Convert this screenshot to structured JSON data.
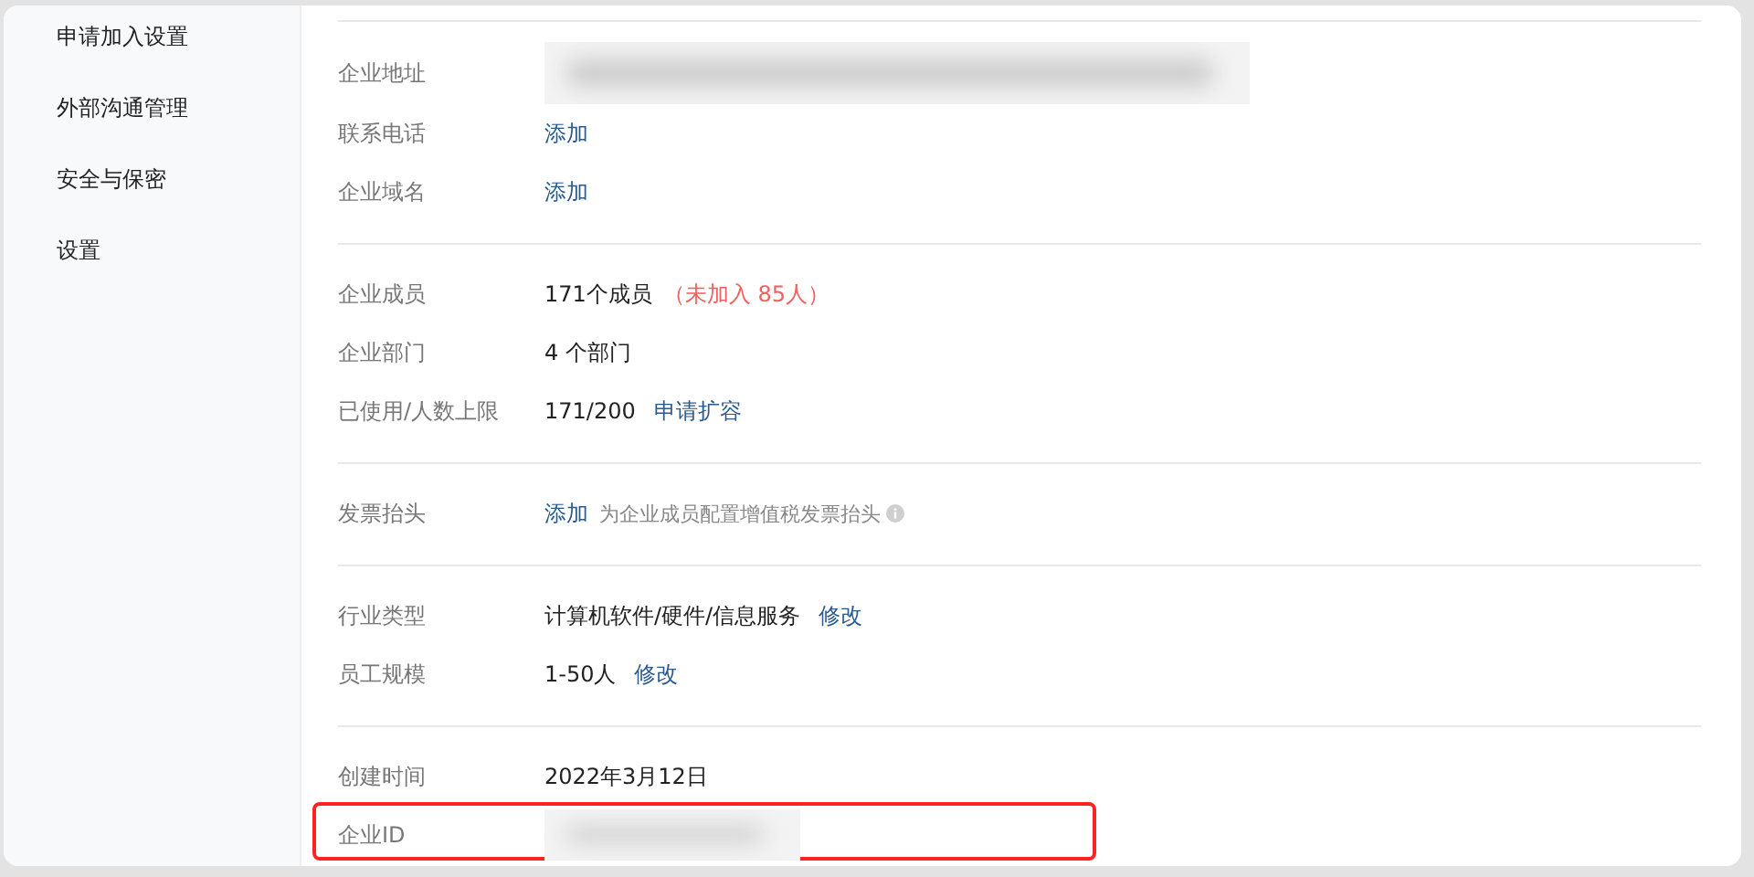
{
  "sidebar": {
    "items": [
      {
        "label": "申请加入设置"
      },
      {
        "label": "外部沟通管理"
      },
      {
        "label": "安全与保密"
      },
      {
        "label": "设置"
      }
    ]
  },
  "sections": [
    {
      "rows": [
        {
          "label": "企业地址",
          "highlighted": false,
          "parts": [
            {
              "kind": "redacted"
            }
          ]
        },
        {
          "label": "联系电话",
          "highlighted": false,
          "parts": [
            {
              "kind": "link",
              "text": "添加"
            }
          ]
        },
        {
          "label": "企业域名",
          "highlighted": false,
          "parts": [
            {
              "kind": "link",
              "text": "添加"
            }
          ]
        }
      ]
    },
    {
      "rows": [
        {
          "label": "企业成员",
          "highlighted": false,
          "parts": [
            {
              "kind": "text",
              "text": "171个成员"
            },
            {
              "kind": "warning",
              "text": "（未加入 85人）"
            }
          ]
        },
        {
          "label": "企业部门",
          "highlighted": false,
          "parts": [
            {
              "kind": "text",
              "text": "4 个部门"
            }
          ]
        },
        {
          "label": "已使用/人数上限",
          "highlighted": false,
          "parts": [
            {
              "kind": "text",
              "text": "171/200"
            },
            {
              "kind": "link",
              "text": "申请扩容"
            }
          ]
        }
      ]
    },
    {
      "rows": [
        {
          "label": "发票抬头",
          "highlighted": false,
          "parts": [
            {
              "kind": "link",
              "text": "添加"
            },
            {
              "kind": "note",
              "text": "为企业成员配置增值税发票抬头"
            },
            {
              "kind": "info"
            }
          ]
        }
      ]
    },
    {
      "rows": [
        {
          "label": "行业类型",
          "highlighted": false,
          "parts": [
            {
              "kind": "text",
              "text": "计算机软件/硬件/信息服务"
            },
            {
              "kind": "link",
              "text": "修改"
            }
          ]
        },
        {
          "label": "员工规模",
          "highlighted": false,
          "parts": [
            {
              "kind": "text",
              "text": "1-50人"
            },
            {
              "kind": "link",
              "text": "修改"
            }
          ]
        }
      ]
    },
    {
      "rows": [
        {
          "label": "创建时间",
          "highlighted": false,
          "parts": [
            {
              "kind": "text",
              "text": "2022年3月12日"
            }
          ]
        },
        {
          "label": "企业ID",
          "highlighted": true,
          "parts": [
            {
              "kind": "redacted"
            }
          ]
        }
      ]
    }
  ]
}
